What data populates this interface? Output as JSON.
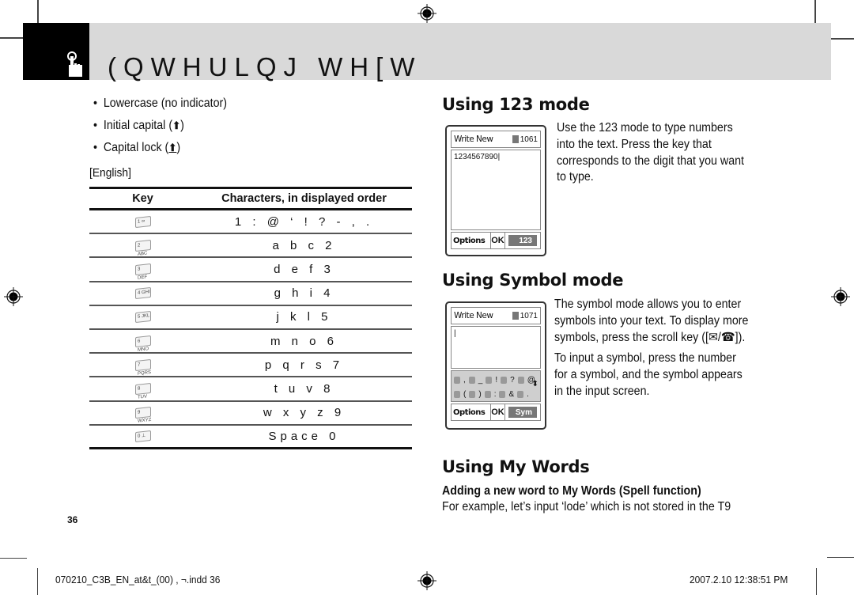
{
  "header": {
    "title": "(QWHULQJ WH[W",
    "icon": "hand-pointer-icon"
  },
  "bullets": [
    {
      "text": "Lowercase (no indicator)",
      "indicator": ""
    },
    {
      "text": "Initial capital (",
      "indicator": "🠉",
      "close": ")"
    },
    {
      "text": "Capital lock (",
      "indicator": "🠉",
      "close": ")"
    }
  ],
  "english_label": "[English]",
  "key_table": {
    "headers": {
      "key": "Key",
      "chars": "Characters, in displayed order"
    },
    "rows": [
      {
        "key": "1 ∞",
        "chars": "1 : @ ‘ ! ? - , ."
      },
      {
        "key": "2 ABC",
        "chars": "a b c 2"
      },
      {
        "key": "3 DEF",
        "chars": "d e f 3"
      },
      {
        "key": "4 GHI",
        "chars": "g h i 4"
      },
      {
        "key": "5 JKL",
        "chars": "j k l 5"
      },
      {
        "key": "6 MNO",
        "chars": "m n o 6"
      },
      {
        "key": "7 PQRS",
        "chars": "p q r s 7"
      },
      {
        "key": "8 TUV",
        "chars": "t u v 8"
      },
      {
        "key": "9 WXYZ",
        "chars": "w x y z 9"
      },
      {
        "key": "0 ⊥",
        "chars": "Space 0"
      }
    ]
  },
  "page_number": "36",
  "section_123": {
    "title": "Using 123 mode",
    "body": [
      "Use the 123 mode to type numbers",
      "into the text. Press the key that",
      "corresponds to the digit that you want",
      "to type."
    ],
    "phone": {
      "title": "Write New",
      "counter": "1061",
      "text": "1234567890|",
      "options": "Options",
      "ok": "OK",
      "mode": "123"
    }
  },
  "section_symbol": {
    "title": "Using Symbol mode",
    "body1": [
      "The symbol mode allows you to enter",
      "symbols into your text. To display more",
      "symbols, press the scroll key ([✉/☎])."
    ],
    "body2": [
      "To input a symbol, press the number",
      "for a symbol, and the symbol appears",
      "in the input screen."
    ],
    "phone": {
      "title": "Write New",
      "counter": "1071",
      "text": "|",
      "symbols_row1": [
        ",",
        "_",
        "!",
        "?",
        "@"
      ],
      "symbols_row2": [
        "(",
        ")",
        ":",
        "&",
        "."
      ],
      "options": "Options",
      "ok": "OK",
      "mode": "Sym"
    }
  },
  "section_mywords": {
    "title": "Using My Words",
    "subtitle": "Adding a new word to My Words (Spell function)",
    "body": "For example, let’s input ‘lode’ which is not stored in the T9"
  },
  "footer": {
    "file": "070210_C3B_EN_at&t_(00) , ¬.indd   36",
    "datetime": "2007.2.10   12:38:51 PM"
  }
}
